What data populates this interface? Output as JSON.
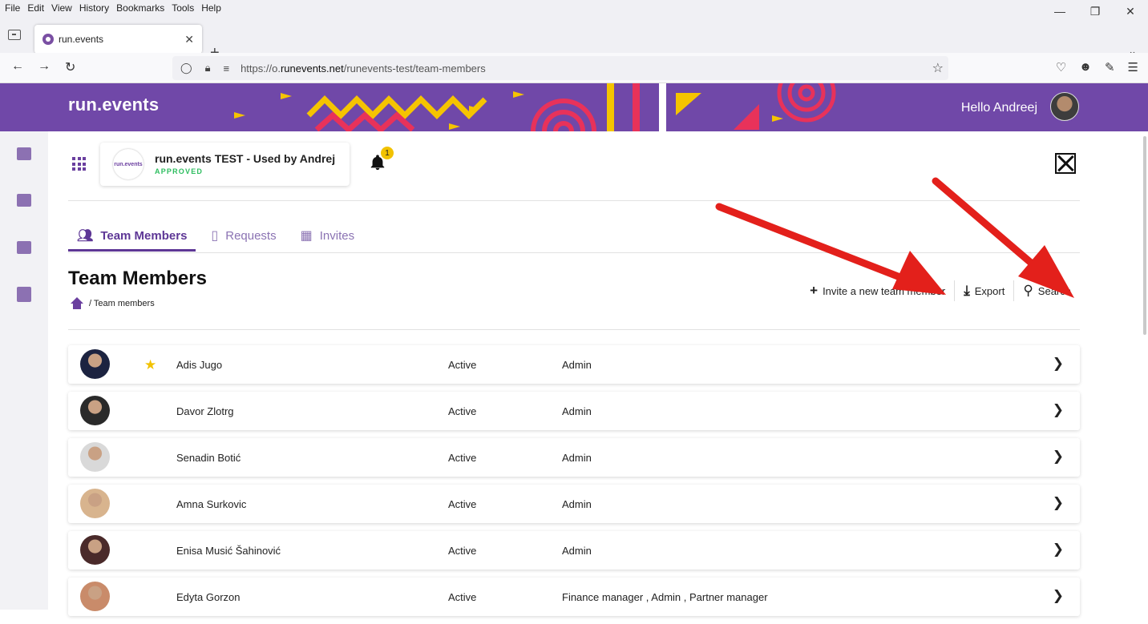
{
  "browser": {
    "menu": [
      "File",
      "Edit",
      "View",
      "History",
      "Bookmarks",
      "Tools",
      "Help"
    ],
    "tab_title": "run.events",
    "url_prefix": "https://o.",
    "url_domain": "runevents.net",
    "url_path": "/runevents-test/team-members"
  },
  "header": {
    "brand": "run.events",
    "greeting": "Hello Andreej",
    "accent": "#7048a8"
  },
  "org": {
    "logo_text": "run.events",
    "name": "run.events TEST - Used by Andrej",
    "status": "APPROVED"
  },
  "notifications": {
    "count": "1"
  },
  "tabs": [
    {
      "label": "Team Members",
      "icon": "people-icon"
    },
    {
      "label": "Requests",
      "icon": "chat-icon"
    },
    {
      "label": "Invites",
      "icon": "invite-icon"
    }
  ],
  "page": {
    "title": "Team Members",
    "breadcrumb": "/ Team members"
  },
  "actions": {
    "invite": "Invite a new team member",
    "export": "Export",
    "search": "Search"
  },
  "members": [
    {
      "name": "Adis Jugo",
      "status": "Active",
      "roles": "Admin",
      "starred": true,
      "avatar_color": "#1c2340"
    },
    {
      "name": "Davor Zlotrg",
      "status": "Active",
      "roles": "Admin",
      "starred": false,
      "avatar_color": "#2a2a2a"
    },
    {
      "name": "Senadin Botić",
      "status": "Active",
      "roles": "Admin",
      "starred": false,
      "avatar_color": "#d9d9d9"
    },
    {
      "name": "Amna Surkovic",
      "status": "Active",
      "roles": "Admin",
      "starred": false,
      "avatar_color": "#d8b48e"
    },
    {
      "name": "Enisa Musić Šahinović",
      "status": "Active",
      "roles": "Admin",
      "starred": false,
      "avatar_color": "#4a2a2a"
    },
    {
      "name": "Edyta Gorzon",
      "status": "Active",
      "roles": "Finance manager , Admin , Partner manager",
      "starred": false,
      "avatar_color": "#c98b6a"
    }
  ]
}
